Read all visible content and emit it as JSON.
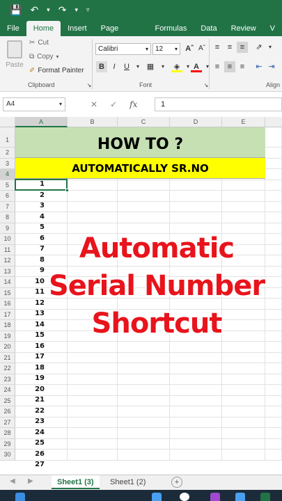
{
  "ribbon_tabs": [
    "File",
    "Home",
    "Insert",
    "Page Layout",
    "Formulas",
    "Data",
    "Review",
    "V"
  ],
  "clipboard": {
    "paste_label": "Paste",
    "cut_label": "Cut",
    "copy_label": "Copy",
    "format_painter_label": "Format Painter",
    "group_label": "Clipboard"
  },
  "font": {
    "name": "Calibri",
    "size": "12",
    "group_label": "Font"
  },
  "alignment": {
    "group_label": "Align"
  },
  "formula_bar": {
    "name_box": "A4",
    "value": "1"
  },
  "columns": [
    "A",
    "B",
    "C",
    "D",
    "E"
  ],
  "rows": [
    "1",
    "2",
    "3",
    "4",
    "5",
    "6",
    "7",
    "8",
    "9",
    "10",
    "11",
    "12",
    "13",
    "14",
    "15",
    "16",
    "17",
    "18",
    "19",
    "20",
    "21",
    "22",
    "23",
    "24",
    "25",
    "26",
    "27",
    "28",
    "29",
    "30"
  ],
  "sheet": {
    "title": "HOW TO ?",
    "subtitle": "AUTOMATICALLY SR.NO",
    "serial_numbers": [
      "1",
      "2",
      "3",
      "4",
      "5",
      "6",
      "7",
      "8",
      "9",
      "10",
      "11",
      "12",
      "13",
      "14",
      "15",
      "16",
      "17",
      "18",
      "19",
      "20",
      "21",
      "22",
      "23",
      "24",
      "25",
      "26",
      "27"
    ]
  },
  "overlay": {
    "line1": "Automatic",
    "line2": "Serial Number",
    "line3": "Shortcut"
  },
  "sheet_tabs": {
    "active": "Sheet1 (3)",
    "other": "Sheet1 (2)"
  },
  "colors": {
    "excel_green": "#217346",
    "title_fill": "#c6e0b4",
    "subtitle_fill": "#ffff00",
    "overlay_text": "#e8141c"
  }
}
